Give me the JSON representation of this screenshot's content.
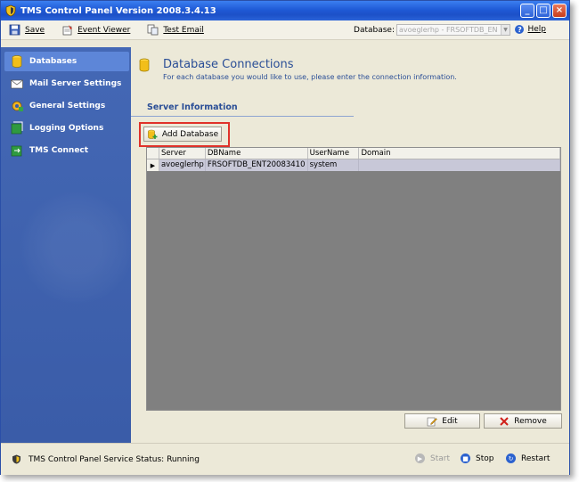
{
  "window": {
    "title": "TMS Control Panel Version 2008.3.4.13"
  },
  "toolbar": {
    "save": "Save",
    "event_viewer": "Event Viewer",
    "test_email": "Test Email",
    "database_label": "Database:",
    "database_value": "avoeglerhp - FRSOFTDB_EN",
    "help": "Help"
  },
  "sidebar": {
    "items": [
      {
        "label": "Databases",
        "icon": "database-icon"
      },
      {
        "label": "Mail Server Settings",
        "icon": "mail-icon"
      },
      {
        "label": "General Settings",
        "icon": "settings-icon"
      },
      {
        "label": "Logging Options",
        "icon": "logging-icon"
      },
      {
        "label": "TMS Connect",
        "icon": "connect-icon"
      }
    ]
  },
  "main": {
    "title": "Database Connections",
    "subtitle": "For each database you would like to use, please enter the connection information.",
    "section": "Server Information",
    "add_button": "Add Database",
    "grid": {
      "columns": [
        "Server",
        "DBName",
        "UserName",
        "Domain"
      ],
      "rows": [
        [
          "avoeglerhp",
          "FRSOFTDB_ENT20083410",
          "system",
          ""
        ]
      ]
    },
    "edit_button": "Edit",
    "remove_button": "Remove"
  },
  "status": {
    "text": "TMS Control Panel Service Status: Running",
    "start": "Start",
    "stop": "Stop",
    "restart": "Restart"
  },
  "colors": {
    "sidebar": "#3a5ca8",
    "accent_title": "#2a4e96",
    "highlight": "#e0322a",
    "grid_bg": "#808080"
  }
}
